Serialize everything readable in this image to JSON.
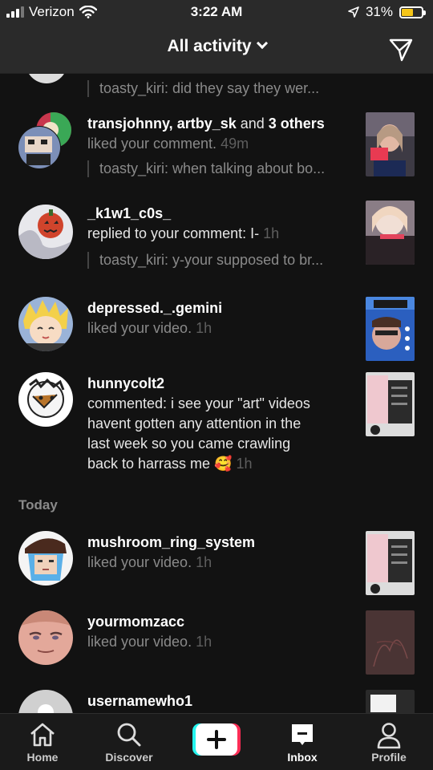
{
  "status_bar": {
    "carrier": "Verizon",
    "time": "3:22 AM",
    "battery": "31%"
  },
  "header": {
    "title": "All activity"
  },
  "feed": {
    "top_partial": {
      "quote": "toasty_kiri: did they say they wer..."
    },
    "items": [
      {
        "names": [
          "transjohnny",
          "artby_sk"
        ],
        "joiner": ", ",
        "and_text": " and ",
        "others": "3 others",
        "action": "liked your comment.",
        "time": "49m",
        "quote": "toasty_kiri: when talking about bo..."
      },
      {
        "name": "_k1w1_c0s_",
        "action": "replied to your comment: I-",
        "time": "1h",
        "quote": "toasty_kiri: y-your supposed to br..."
      },
      {
        "name": "depressed._.gemini",
        "action": "liked your video.",
        "time": "1h"
      },
      {
        "name": "hunnycolt2",
        "action_lines": [
          "commented: i see your \"art\" videos",
          "havent gotten any attention in the",
          "last week so you came crawling",
          "back to harrass me"
        ],
        "emoji": "🥰",
        "time": "1h"
      }
    ],
    "section": "Today",
    "today_items": [
      {
        "name": "mushroom_ring_system",
        "action": "liked your video.",
        "time": "1h"
      },
      {
        "name": "yourmomzacc",
        "action": "liked your video.",
        "time": "1h"
      },
      {
        "name": "usernamewho1"
      }
    ]
  },
  "nav": {
    "items": [
      {
        "label": "Home",
        "icon": "home-icon"
      },
      {
        "label": "Discover",
        "icon": "search-icon"
      },
      {
        "label": "Inbox",
        "icon": "inbox-icon"
      },
      {
        "label": "Profile",
        "icon": "profile-icon"
      }
    ]
  },
  "colors": {
    "background": "#121212",
    "header": "#2a2a2a",
    "muted": "#8a8a8a",
    "accent_cyan": "#25f4ee",
    "accent_red": "#fe2c55"
  }
}
